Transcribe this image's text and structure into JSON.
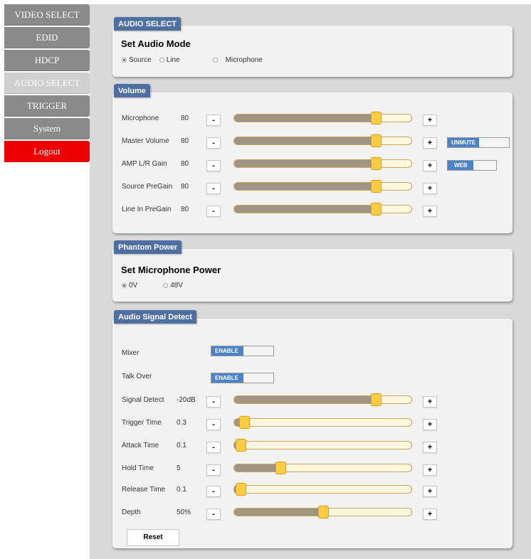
{
  "sidebar": {
    "items": [
      {
        "label": "VIDEO SELECT"
      },
      {
        "label": "EDID"
      },
      {
        "label": "HDCP"
      },
      {
        "label": "AUDIO SELECT"
      },
      {
        "label": "TRIGGER"
      },
      {
        "label": "System"
      },
      {
        "label": "Logout"
      }
    ],
    "active": "AUDIO SELECT"
  },
  "audio_select": {
    "tag": "AUDIO SELECT",
    "heading": "Set Audio Mode",
    "options": [
      "Source",
      "Line",
      "Microphone"
    ],
    "selected": "Source"
  },
  "volume": {
    "tag": "Volume",
    "rows": [
      {
        "label": "Microphone",
        "value": "80",
        "level": 0.8
      },
      {
        "label": "Master Volume",
        "value": "80",
        "level": 0.8
      },
      {
        "label": "AMP L/R Gain",
        "value": "80",
        "level": 0.8
      },
      {
        "label": "Source PreGain",
        "value": "80",
        "level": 0.8
      },
      {
        "label": "Line In PreGain",
        "value": "80",
        "level": 0.8
      }
    ],
    "minus_label": "-",
    "plus_label": "+",
    "unmute_label": "UNMUTE",
    "web_label": "WEB"
  },
  "phantom": {
    "tag": "Phantom Power",
    "heading": "Set Microphone Power",
    "options": [
      "0V",
      "48V"
    ],
    "selected": "0V"
  },
  "signal_detect": {
    "tag": "Audio Signal Detect",
    "mixer_label": "Mixer",
    "mixer_toggle": "ENABLE",
    "talkover_label": "Talk Over",
    "talkover_toggle": "ENABLE",
    "rows": [
      {
        "label": "Signal Detect",
        "value": "-20dB",
        "level": 0.8
      },
      {
        "label": "Trigger Time",
        "value": "0.3",
        "level": 0.03
      },
      {
        "label": "Attack Time",
        "value": "0.1",
        "level": 0.01
      },
      {
        "label": "Hold Time",
        "value": "5",
        "level": 0.26
      },
      {
        "label": "Release Time",
        "value": "0.1",
        "level": 0.01
      },
      {
        "label": "Depth",
        "value": "50%",
        "level": 0.5
      }
    ],
    "reset_label": "Reset"
  },
  "colors": {
    "nav": "#8a8a8a",
    "nav_active": "#cfcfcf",
    "logout": "#ee0000",
    "panel_tag": "#4f6fa3",
    "slider_fill": "#a09684",
    "slider_thumb": "#ffcc44",
    "toggle_on": "#4a83c9"
  }
}
